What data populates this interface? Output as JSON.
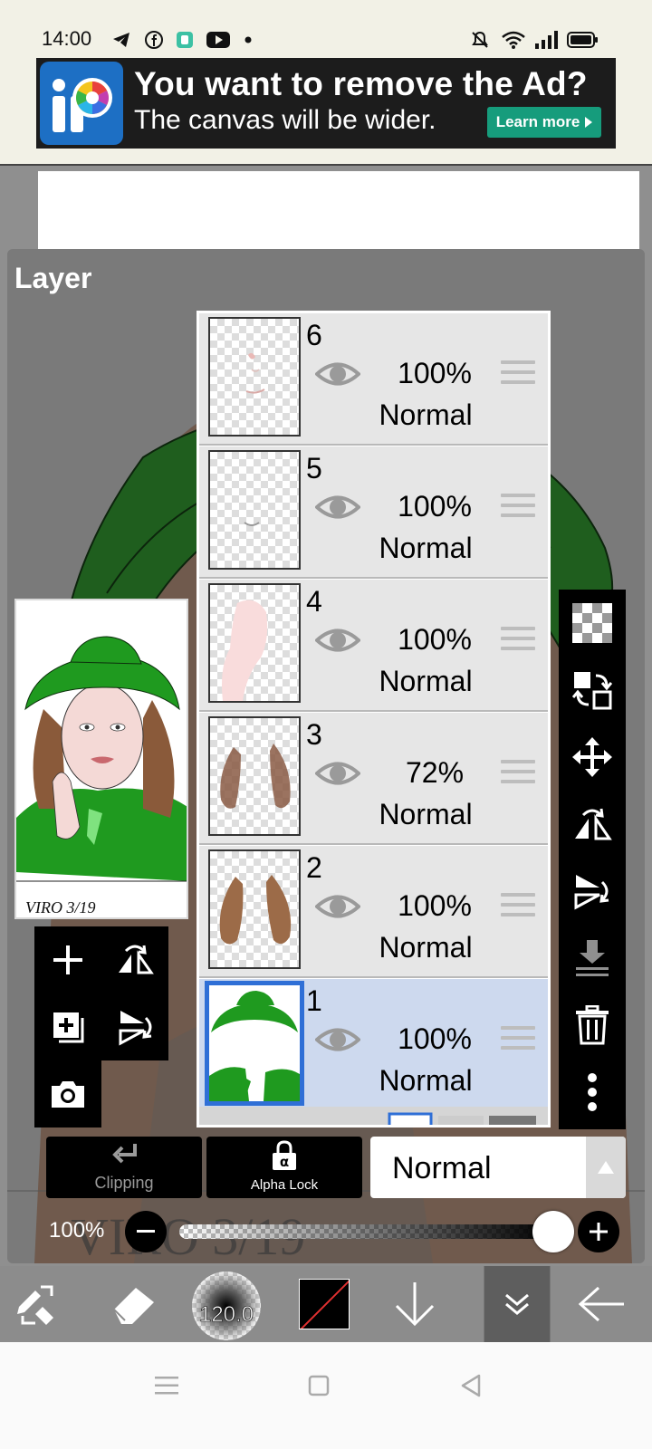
{
  "status_bar": {
    "time": "14:00",
    "icons": [
      "telegram-icon",
      "facebook-icon",
      "app-icon",
      "youtube-icon",
      "dot-icon",
      "mute-icon",
      "wifi-icon",
      "signal-icon",
      "battery-icon"
    ]
  },
  "ad": {
    "title": "You want to remove the Ad?",
    "subtitle": "The canvas will be wider.",
    "learn_more": "Learn more"
  },
  "panel": {
    "title": "Layer"
  },
  "layers": [
    {
      "number": "6",
      "opacity": "100%",
      "blend": "Normal",
      "selected": false
    },
    {
      "number": "5",
      "opacity": "100%",
      "blend": "Normal",
      "selected": false
    },
    {
      "number": "4",
      "opacity": "100%",
      "blend": "Normal",
      "selected": false
    },
    {
      "number": "3",
      "opacity": "72%",
      "blend": "Normal",
      "selected": false
    },
    {
      "number": "2",
      "opacity": "100%",
      "blend": "Normal",
      "selected": false
    },
    {
      "number": "1",
      "opacity": "100%",
      "blend": "Normal",
      "selected": true
    }
  ],
  "controls": {
    "clipping": "Clipping",
    "alpha_lock": "Alpha Lock",
    "blend_mode": "Normal",
    "opacity_label": "100%",
    "opacity_value": 100
  },
  "toolbar": {
    "brush_size": "120.0"
  },
  "colors": {
    "selected_layer_bg": "#cdd9ee",
    "selected_border": "#2f6fd6",
    "ad_button": "#169c7c",
    "hat_green": "#1f9a1f"
  }
}
